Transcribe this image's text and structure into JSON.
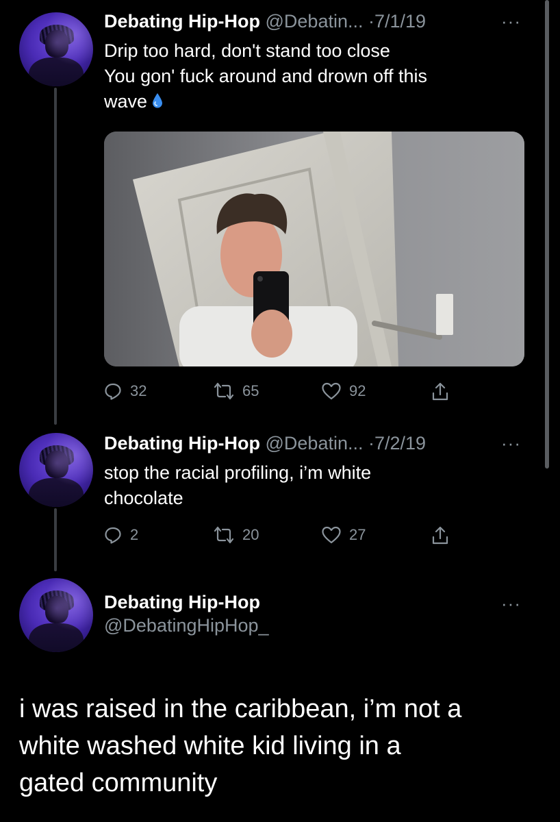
{
  "tweets": [
    {
      "name": "Debating Hip-Hop",
      "handle": "@Debatin...",
      "date": "·7/1/19",
      "more": "···",
      "text_lines": [
        "Drip too hard, don't stand too close",
        "You gon' fuck around and drown off this",
        "wave"
      ],
      "emoji": "droplet",
      "media": "mirror selfie of a young man holding a black phone in front of a white door",
      "replies": "32",
      "retweets": "65",
      "likes": "92"
    },
    {
      "name": "Debating Hip-Hop",
      "handle": "@Debatin...",
      "date": "·7/2/19",
      "more": "···",
      "text_lines": [
        "stop the racial profiling, i’m white",
        "chocolate"
      ],
      "replies": "2",
      "retweets": "20",
      "likes": "27"
    }
  ],
  "main_tweet": {
    "name": "Debating Hip-Hop",
    "handle": "@DebatingHipHop_",
    "more": "···",
    "text_lines": [
      "i was raised in the caribbean, i’m not a",
      "white washed white kid living in a",
      "gated community"
    ]
  },
  "icons": {
    "reply": "reply-icon",
    "retweet": "retweet-icon",
    "like": "heart-icon",
    "share": "share-icon",
    "more": "more-icon"
  },
  "colors": {
    "background": "#000000",
    "text": "#ffffff",
    "muted": "#8b949c",
    "thread_line": "#3a3d42",
    "avatar_accent": "#5a3bd0"
  }
}
